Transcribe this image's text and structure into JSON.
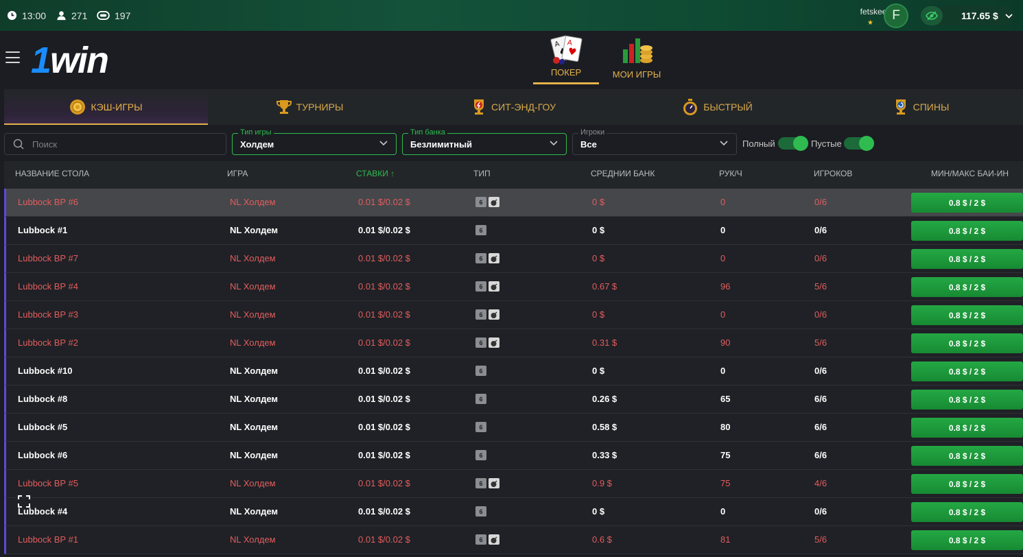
{
  "topbar": {
    "time": "13:00",
    "players_online": "271",
    "tables_count": "197",
    "username": "fetskeel",
    "avatar_letter": "F",
    "balance": "117.65 $"
  },
  "header": {
    "logo": "1win",
    "nav": [
      {
        "label": "ПОКЕР",
        "active": true
      },
      {
        "label": "МОИ ИГРЫ",
        "active": false
      }
    ]
  },
  "tabs": [
    {
      "label": "КЭШ-ИГРЫ",
      "icon": "chip-icon",
      "active": true
    },
    {
      "label": "ТУРНИРЫ",
      "icon": "trophy-icon",
      "active": false
    },
    {
      "label": "СИТ-ЭНД-ГОУ",
      "icon": "trophy-lightning-icon",
      "active": false
    },
    {
      "label": "БЫСТРЫЙ",
      "icon": "stopwatch-icon",
      "active": false
    },
    {
      "label": "СПИНЫ",
      "icon": "spin-trophy-icon",
      "active": false
    }
  ],
  "filters": {
    "search_placeholder": "Поиск",
    "game_type": {
      "legend": "Тип игры",
      "value": "Холдем"
    },
    "bank_type": {
      "legend": "Тип банка",
      "value": "Безлимитный"
    },
    "players": {
      "legend": "Игроки",
      "value": "Все"
    },
    "toggle_full": "Полный",
    "toggle_empty": "Пустые"
  },
  "table": {
    "columns": [
      "НАЗВАНИЕ СТОЛА",
      "ИГРА",
      "СТАВКИ",
      "ТИП",
      "СРЕДНИИ БАНК",
      "РУК/Ч",
      "ИГРОКОВ",
      "МИН/МАКС БАИ-ИН"
    ],
    "sort_arrow": "↑",
    "rows": [
      {
        "name": "Lubbock BP #6",
        "game": "NL Холдем",
        "stakes": "0.01 $/0.02 $",
        "seats": "6",
        "bomb": true,
        "avg_pot": "0 $",
        "hands": "0",
        "players": "0/6",
        "buyin": "0.8 $ / 2 $",
        "style": "red",
        "highlight": true
      },
      {
        "name": "Lubbock #1",
        "game": "NL Холдем",
        "stakes": "0.01 $/0.02 $",
        "seats": "6",
        "bomb": false,
        "avg_pot": "0 $",
        "hands": "0",
        "players": "0/6",
        "buyin": "0.8 $ / 2 $",
        "style": "white",
        "highlight": false
      },
      {
        "name": "Lubbock BP #7",
        "game": "NL Холдем",
        "stakes": "0.01 $/0.02 $",
        "seats": "6",
        "bomb": true,
        "avg_pot": "0 $",
        "hands": "0",
        "players": "0/6",
        "buyin": "0.8 $ / 2 $",
        "style": "red",
        "highlight": false
      },
      {
        "name": "Lubbock BP #4",
        "game": "NL Холдем",
        "stakes": "0.01 $/0.02 $",
        "seats": "6",
        "bomb": true,
        "avg_pot": "0.67 $",
        "hands": "96",
        "players": "5/6",
        "buyin": "0.8 $ / 2 $",
        "style": "red",
        "highlight": false
      },
      {
        "name": "Lubbock BP #3",
        "game": "NL Холдем",
        "stakes": "0.01 $/0.02 $",
        "seats": "6",
        "bomb": true,
        "avg_pot": "0 $",
        "hands": "0",
        "players": "0/6",
        "buyin": "0.8 $ / 2 $",
        "style": "red",
        "highlight": false
      },
      {
        "name": "Lubbock BP #2",
        "game": "NL Холдем",
        "stakes": "0.01 $/0.02 $",
        "seats": "6",
        "bomb": true,
        "avg_pot": "0.31 $",
        "hands": "90",
        "players": "5/6",
        "buyin": "0.8 $ / 2 $",
        "style": "red",
        "highlight": false
      },
      {
        "name": "Lubbock #10",
        "game": "NL Холдем",
        "stakes": "0.01 $/0.02 $",
        "seats": "6",
        "bomb": false,
        "avg_pot": "0 $",
        "hands": "0",
        "players": "0/6",
        "buyin": "0.8 $ / 2 $",
        "style": "white",
        "highlight": false
      },
      {
        "name": "Lubbock #8",
        "game": "NL Холдем",
        "stakes": "0.01 $/0.02 $",
        "seats": "6",
        "bomb": false,
        "avg_pot": "0.26 $",
        "hands": "65",
        "players": "6/6",
        "buyin": "0.8 $ / 2 $",
        "style": "white",
        "highlight": false
      },
      {
        "name": "Lubbock #5",
        "game": "NL Холдем",
        "stakes": "0.01 $/0.02 $",
        "seats": "6",
        "bomb": false,
        "avg_pot": "0.58 $",
        "hands": "80",
        "players": "6/6",
        "buyin": "0.8 $ / 2 $",
        "style": "white",
        "highlight": false
      },
      {
        "name": "Lubbock #6",
        "game": "NL Холдем",
        "stakes": "0.01 $/0.02 $",
        "seats": "6",
        "bomb": false,
        "avg_pot": "0.33 $",
        "hands": "75",
        "players": "6/6",
        "buyin": "0.8 $ / 2 $",
        "style": "white",
        "highlight": false
      },
      {
        "name": "Lubbock BP #5",
        "game": "NL Холдем",
        "stakes": "0.01 $/0.02 $",
        "seats": "6",
        "bomb": true,
        "avg_pot": "0.9 $",
        "hands": "75",
        "players": "4/6",
        "buyin": "0.8 $ / 2 $",
        "style": "red",
        "highlight": false
      },
      {
        "name": "Lubbock #4",
        "game": "NL Холдем",
        "stakes": "0.01 $/0.02 $",
        "seats": "6",
        "bomb": false,
        "avg_pot": "0 $",
        "hands": "0",
        "players": "0/6",
        "buyin": "0.8 $ / 2 $",
        "style": "white",
        "highlight": false
      },
      {
        "name": "Lubbock BP #1",
        "game": "NL Холдем",
        "stakes": "0.01 $/0.02 $",
        "seats": "6",
        "bomb": true,
        "avg_pot": "0.6 $",
        "hands": "81",
        "players": "5/6",
        "buyin": "0.8 $ / 2 $",
        "style": "red",
        "highlight": false
      }
    ]
  }
}
